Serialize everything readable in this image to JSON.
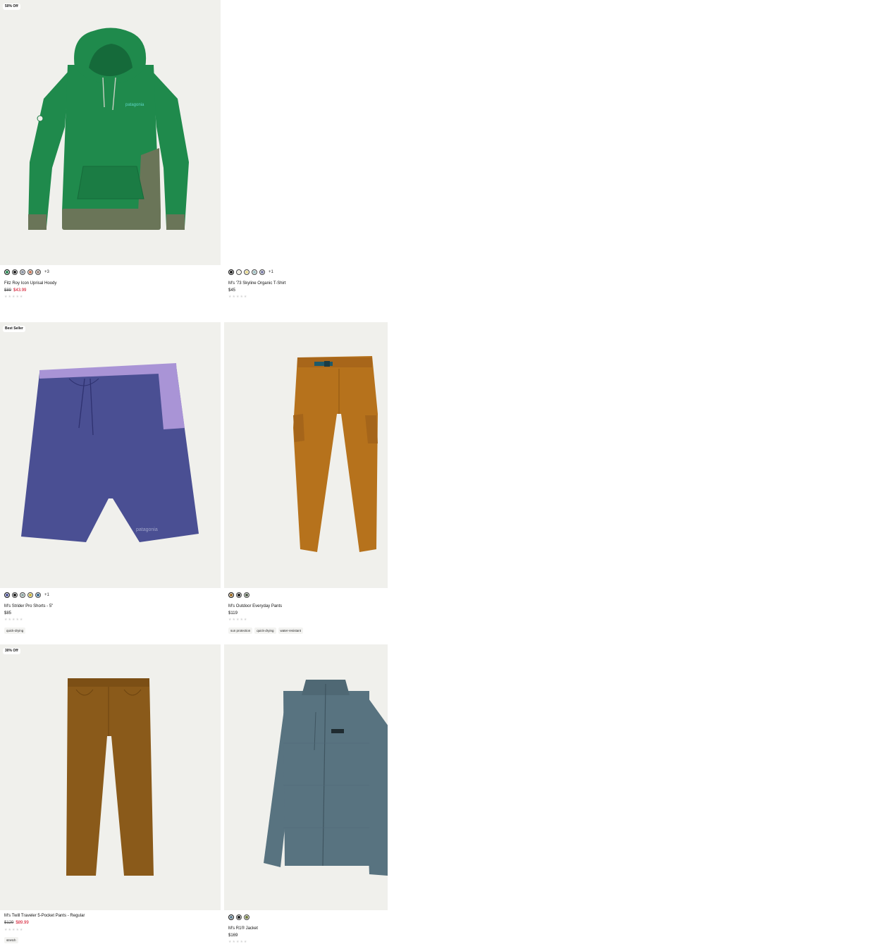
{
  "products": [
    {
      "id": "hoody",
      "badge": "50% Off",
      "name": "Fitz Roy Icon Uprisal Hoody",
      "price_was": "$89",
      "price_now": "$43.99",
      "swatches": [
        "#2e8a57",
        "#1d1d1d",
        "#8d95a3",
        "#c9785a",
        "#a58f85"
      ],
      "more": "+3",
      "rating": "★★★★★",
      "tags": []
    },
    {
      "id": "tshirt",
      "badge": "",
      "name": "M's '73 Skyline Organic T-Shirt",
      "price": "$45",
      "swatches": [
        "#1d1d1d",
        "#f2f0e4",
        "#e8d98c",
        "#9fc2c4",
        "#7d7fa8"
      ],
      "more": "+1",
      "rating": "★★★★★",
      "tags": []
    },
    {
      "id": "shorts",
      "badge": "Best Seller",
      "name": "M's Strider Pro Shorts - 5\"",
      "price": "$85",
      "swatches": [
        "#4f5596",
        "#1d1d1d",
        "#8fa7a4",
        "#c8b339",
        "#3b6a8f"
      ],
      "more": "+1",
      "rating": "★★★★★",
      "tags": [
        "quick-drying"
      ]
    },
    {
      "id": "pants",
      "badge": "",
      "name": "M's Outdoor Everyday Pants",
      "price": "$119",
      "swatches": [
        "#9b6a21",
        "#1d1d1d",
        "#4c5a46"
      ],
      "more": "",
      "rating": "★★★★★",
      "tags": [
        "sun protection",
        "quick-drying",
        "water-resistant"
      ]
    },
    {
      "id": "twill",
      "badge": "30% Off",
      "name": "M's Twill Traveler 5-Pocket Pants - Regular",
      "price_was": "$129",
      "price_now": "$89.99",
      "swatches": [],
      "more": "",
      "rating": "★★★★★",
      "tags": [
        "stretch"
      ]
    },
    {
      "id": "r1",
      "badge": "",
      "name": "M's R1® Jacket",
      "price": "$169",
      "swatches": [
        "#5d7b8f",
        "#1d1d1d",
        "#6e7a3a"
      ],
      "more": "",
      "rating": "★★★★★",
      "tags": []
    }
  ],
  "colors": {
    "image_bg": "#f0f0ec",
    "sale_price": "#d0021b",
    "hoody": "#1f8a4c",
    "hoody_trim": "#6a7558",
    "shorts": "#4a4f93",
    "shorts_panel": "#a994d6",
    "pants": "#b6721c",
    "twill": "#8a5a1a",
    "jacket": "#587380"
  }
}
